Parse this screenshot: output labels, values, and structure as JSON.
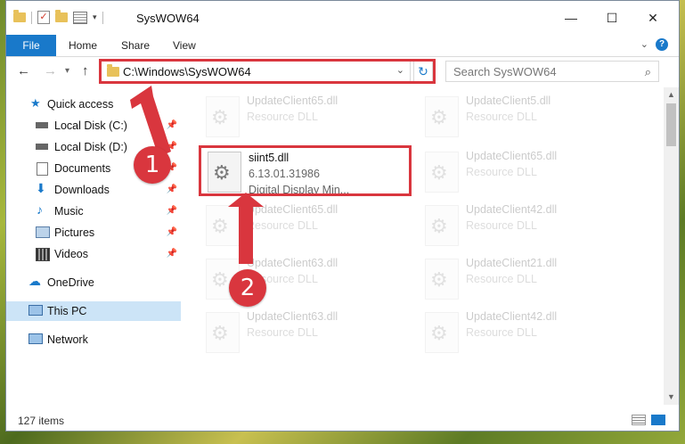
{
  "window": {
    "title": "SysWOW64",
    "controls": {
      "minimize": "—",
      "maximize": "☐",
      "close": "✕"
    }
  },
  "ribbon": {
    "tabs": [
      "File",
      "Home",
      "Share",
      "View"
    ],
    "help": "?"
  },
  "address_bar": {
    "path": "C:\\Windows\\SysWOW64"
  },
  "search": {
    "placeholder": "Search SysWOW64"
  },
  "sidebar": {
    "items": [
      {
        "label": "Quick access",
        "icon": "star-icon",
        "pinned": false
      },
      {
        "label": "Local Disk (C:)",
        "icon": "drive-icon",
        "pinned": true
      },
      {
        "label": "Local Disk (D:)",
        "icon": "drive-icon",
        "pinned": true
      },
      {
        "label": "Documents",
        "icon": "document-icon",
        "pinned": true
      },
      {
        "label": "Downloads",
        "icon": "download-icon",
        "pinned": true
      },
      {
        "label": "Music",
        "icon": "music-icon",
        "pinned": true
      },
      {
        "label": "Pictures",
        "icon": "picture-icon",
        "pinned": true
      },
      {
        "label": "Videos",
        "icon": "video-icon",
        "pinned": true
      },
      {
        "label": "OneDrive",
        "icon": "cloud-icon",
        "pinned": false
      },
      {
        "label": "This PC",
        "icon": "computer-icon",
        "pinned": false,
        "selected": true
      },
      {
        "label": "Network",
        "icon": "network-icon",
        "pinned": false
      }
    ]
  },
  "files": {
    "left": [
      {
        "name": "UpdateClient65.dll",
        "type": "Resource DLL",
        "faded": true
      },
      {
        "name": "siint5.dll",
        "version": "6.13.01.31986",
        "description": "Digital Display Min...",
        "faded": false
      },
      {
        "name": "UpdateClient65.dll",
        "type": "Resource DLL",
        "faded": true
      },
      {
        "name": "UpdateClient63.dll",
        "type": "Resource DLL",
        "faded": true
      },
      {
        "name": "UpdateClient63.dll",
        "type": "Resource DLL",
        "faded": true
      }
    ],
    "right": [
      {
        "name": "UpdateClient5.dll",
        "type": "Resource DLL",
        "faded": true
      },
      {
        "name": "UpdateClient65.dll",
        "type": "Resource DLL",
        "faded": true
      },
      {
        "name": "UpdateClient42.dll",
        "type": "Resource DLL",
        "faded": true
      },
      {
        "name": "UpdateClient21.dll",
        "type": "Resource DLL",
        "faded": true
      },
      {
        "name": "UpdateClient42.dll",
        "type": "Resource DLL",
        "faded": true
      }
    ]
  },
  "status_bar": {
    "item_count": "127 items"
  },
  "annotations": {
    "badge1": "1",
    "badge2": "2",
    "color": "#d9363e"
  }
}
